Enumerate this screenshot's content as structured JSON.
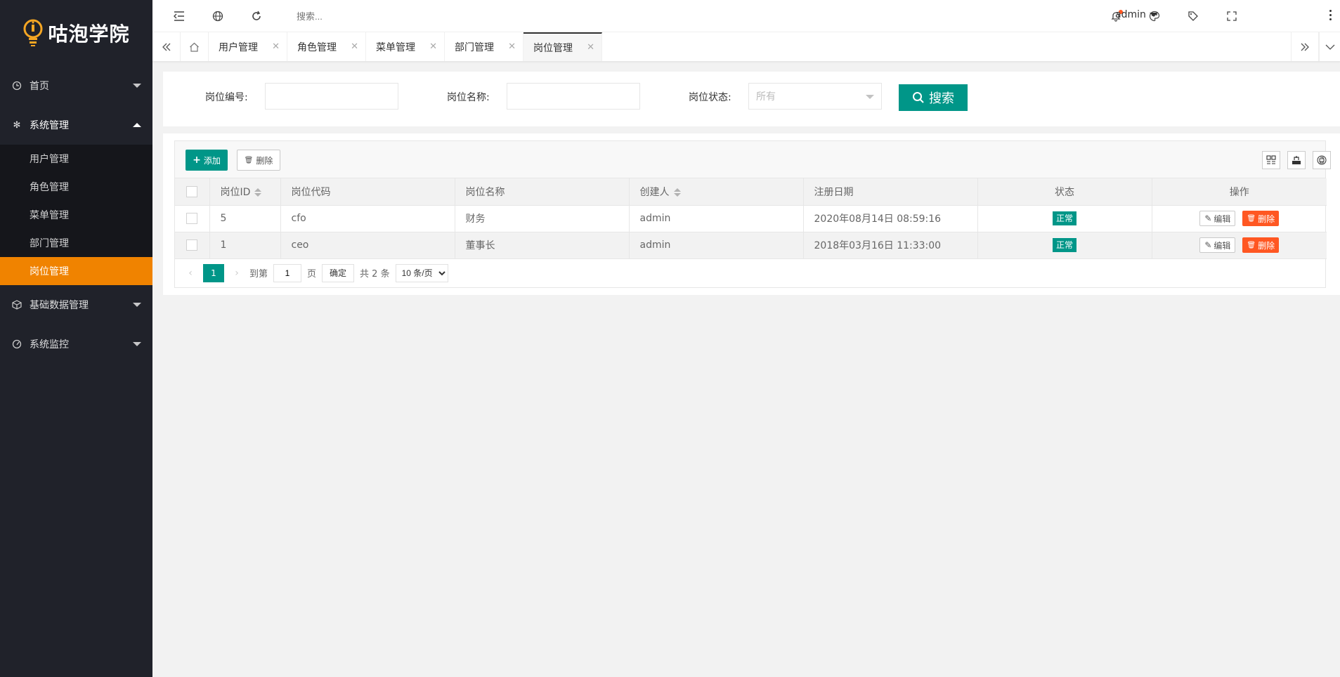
{
  "brand": {
    "name": "咕泡学院"
  },
  "header": {
    "search_placeholder": "搜索...",
    "user": "admin"
  },
  "sidebar": {
    "items": [
      {
        "label": "首页",
        "icon": "home-icon"
      },
      {
        "label": "系统管理",
        "icon": "gear-icon"
      },
      {
        "label": "基础数据管理",
        "icon": "cube-icon"
      },
      {
        "label": "系统监控",
        "icon": "dashboard-icon"
      }
    ],
    "sub_items": [
      "用户管理",
      "角色管理",
      "菜单管理",
      "部门管理",
      "岗位管理"
    ]
  },
  "tabs": [
    "用户管理",
    "角色管理",
    "菜单管理",
    "部门管理",
    "岗位管理"
  ],
  "filter": {
    "post_code_label": "岗位编号:",
    "post_name_label": "岗位名称:",
    "status_label": "岗位状态:",
    "status_value": "所有",
    "search_button": "搜索"
  },
  "toolbar": {
    "add_label": "添加",
    "delete_label": "删除"
  },
  "table": {
    "headers": [
      "岗位ID",
      "岗位代码",
      "岗位名称",
      "创建人",
      "注册日期",
      "状态",
      "操作"
    ],
    "rows": [
      {
        "id": "5",
        "code": "cfo",
        "name": "财务",
        "creator": "admin",
        "date": "2020年08月14日 08:59:16",
        "status": "正常"
      },
      {
        "id": "1",
        "code": "ceo",
        "name": "董事长",
        "creator": "admin",
        "date": "2018年03月16日 11:33:00",
        "status": "正常"
      }
    ],
    "edit_label": "编辑",
    "delete_label": "删除"
  },
  "pager": {
    "current": "1",
    "goto_label": "到第",
    "goto_value": "1",
    "page_label": "页",
    "confirm": "确定",
    "total": "共 2 条",
    "page_size": "10 条/页"
  },
  "colors": {
    "primary": "#009688",
    "accent": "#f08300",
    "danger": "#ff5722",
    "sidebar_bg": "#20222a"
  }
}
